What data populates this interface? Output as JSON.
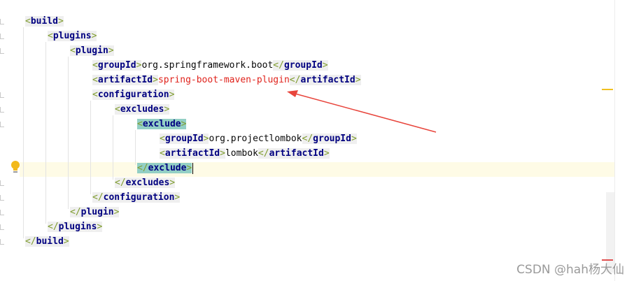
{
  "editor": {
    "language": "xml",
    "lines": [
      {
        "indent": 0,
        "kind": "open",
        "tag": "build"
      },
      {
        "indent": 1,
        "kind": "open",
        "tag": "plugins"
      },
      {
        "indent": 2,
        "kind": "open",
        "tag": "plugin"
      },
      {
        "indent": 3,
        "kind": "element",
        "tag": "groupId",
        "value": "org.springframework.boot"
      },
      {
        "indent": 3,
        "kind": "element",
        "tag": "artifactId",
        "value": "spring-boot-maven-plugin",
        "value_color": "#e0231c"
      },
      {
        "indent": 3,
        "kind": "open",
        "tag": "configuration"
      },
      {
        "indent": 4,
        "kind": "open",
        "tag": "excludes"
      },
      {
        "indent": 5,
        "kind": "open",
        "tag": "exclude",
        "highlighted": true
      },
      {
        "indent": 6,
        "kind": "element",
        "tag": "groupId",
        "value": "org.projectlombok"
      },
      {
        "indent": 6,
        "kind": "element",
        "tag": "artifactId",
        "value": "lombok"
      },
      {
        "indent": 5,
        "kind": "close",
        "tag": "exclude",
        "highlighted": true,
        "caret": true
      },
      {
        "indent": 4,
        "kind": "close",
        "tag": "excludes"
      },
      {
        "indent": 3,
        "kind": "close",
        "tag": "configuration"
      },
      {
        "indent": 2,
        "kind": "close",
        "tag": "plugin"
      },
      {
        "indent": 1,
        "kind": "close",
        "tag": "plugins"
      },
      {
        "indent": 0,
        "kind": "close",
        "tag": "build"
      }
    ],
    "current_line": 11
  },
  "gutter": {
    "intention_icon": "lightbulb-icon"
  },
  "annotation": {
    "type": "red-arrow",
    "points_to_line": 5,
    "color": "#e8453c"
  },
  "colors": {
    "tag_name": "#000080",
    "bracket": "#7f9c2f",
    "tag_bg": "#efefef",
    "tag_match_bg": "#93cfc5",
    "current_line_bg": "#fefbe6"
  },
  "watermark": "CSDN @hah杨大仙"
}
